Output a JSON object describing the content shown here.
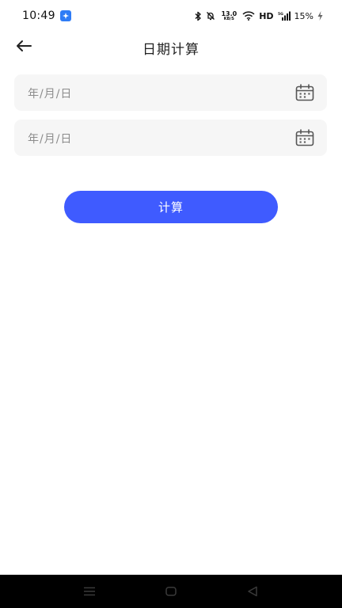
{
  "status_bar": {
    "time": "10:49",
    "net_speed_value": "13.0",
    "net_speed_unit": "KB/S",
    "hd_label": "HD",
    "battery_percent": "15%",
    "icons": [
      "app-notification-icon",
      "bluetooth-icon",
      "mute-icon",
      "wifi-icon",
      "signal-icon",
      "charging-icon"
    ]
  },
  "header": {
    "title": "日期计算",
    "back_icon": "arrow-left-icon"
  },
  "form": {
    "start_date_placeholder": "年/月/日",
    "end_date_placeholder": "年/月/日",
    "calendar_icon": "calendar-icon"
  },
  "actions": {
    "calculate_label": "计算"
  },
  "colors": {
    "accent": "#3f5bff",
    "field_bg": "#f6f6f6",
    "placeholder": "#8c8c8c",
    "nav_bar": "#000000"
  },
  "nav_bar": {
    "icons": [
      "menu-icon",
      "home-icon",
      "back-triangle-icon"
    ]
  }
}
